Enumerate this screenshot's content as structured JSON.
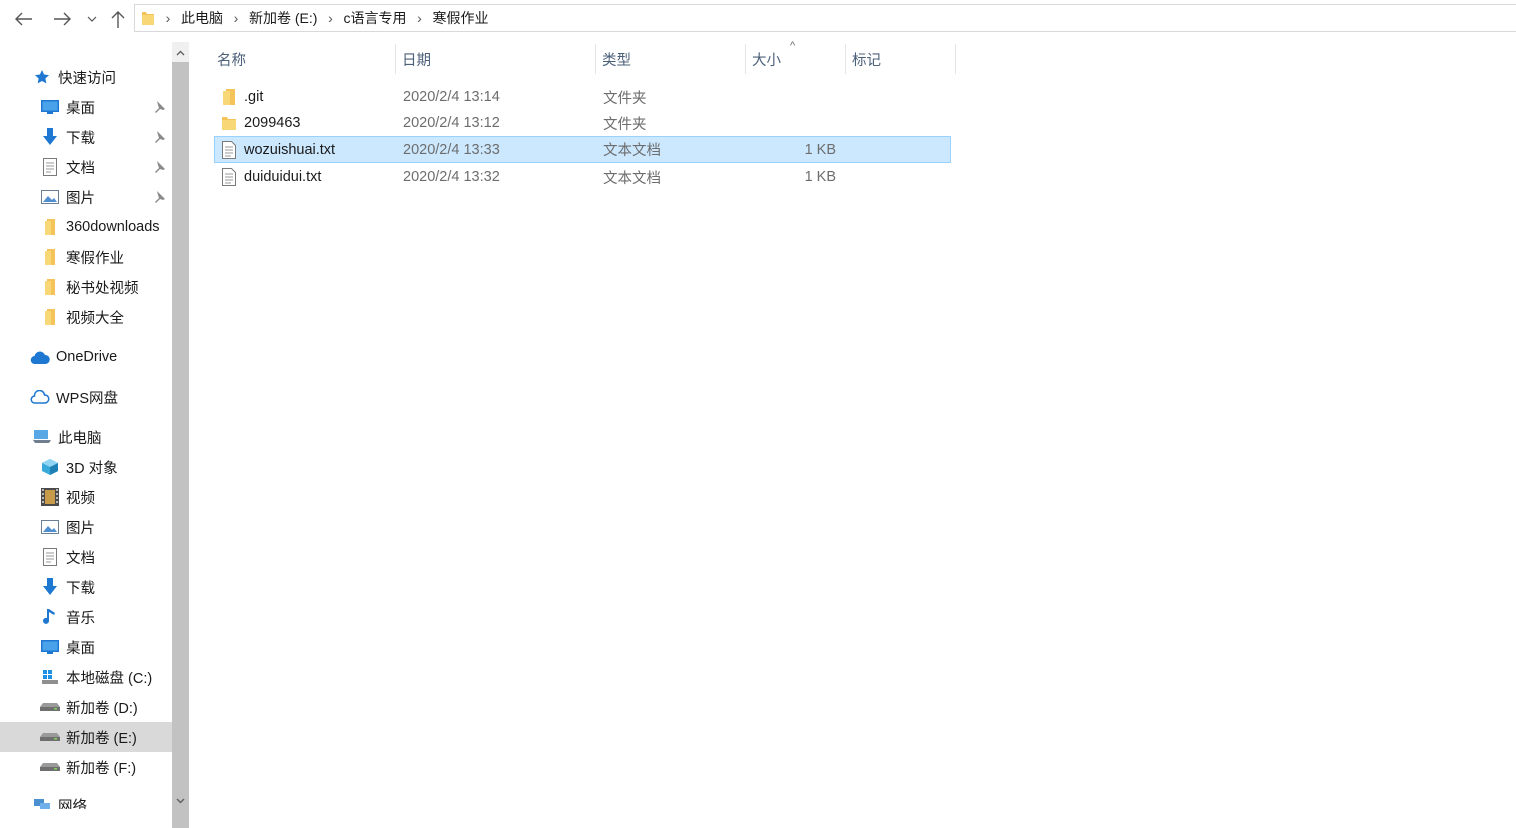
{
  "toolbar": {
    "back_icon": "arrow-left-icon",
    "forward_icon": "arrow-right-icon",
    "recent_icon": "chevron-down-icon",
    "up_icon": "arrow-up-icon"
  },
  "breadcrumb": [
    "此电脑",
    "新加卷 (E:)",
    "c语言专用",
    "寒假作业"
  ],
  "sidebar": {
    "quick_access": "快速访问",
    "quick_items": [
      {
        "label": "桌面",
        "icon": "desktop-icon"
      },
      {
        "label": "下载",
        "icon": "download-icon"
      },
      {
        "label": "文档",
        "icon": "document-icon"
      },
      {
        "label": "图片",
        "icon": "picture-icon"
      },
      {
        "label": "360downloads",
        "icon": "folder-icon"
      },
      {
        "label": "寒假作业",
        "icon": "folder-icon"
      },
      {
        "label": "秘书处视频",
        "icon": "folder-icon"
      },
      {
        "label": "视频大全",
        "icon": "folder-icon"
      }
    ],
    "onedrive": "OneDrive",
    "wps": "WPS网盘",
    "this_pc": "此电脑",
    "pc_items": [
      {
        "label": "3D 对象",
        "icon": "cube-icon"
      },
      {
        "label": "视频",
        "icon": "video-icon"
      },
      {
        "label": "图片",
        "icon": "picture-icon"
      },
      {
        "label": "文档",
        "icon": "document-icon"
      },
      {
        "label": "下载",
        "icon": "download-icon"
      },
      {
        "label": "音乐",
        "icon": "music-icon"
      },
      {
        "label": "桌面",
        "icon": "desktop-icon"
      },
      {
        "label": "本地磁盘 (C:)",
        "icon": "windows-drive-icon"
      },
      {
        "label": "新加卷 (D:)",
        "icon": "drive-icon"
      },
      {
        "label": "新加卷 (E:)",
        "icon": "drive-icon",
        "selected": true
      },
      {
        "label": "新加卷 (F:)",
        "icon": "drive-icon"
      }
    ],
    "network": "网络"
  },
  "columns": {
    "name": "名称",
    "date": "日期",
    "type": "类型",
    "size": "大小",
    "tags": "标记"
  },
  "sort_indicator": "^",
  "files": [
    {
      "name": ".git",
      "date": "2020/2/4 13:14",
      "type": "文件夹",
      "size": "",
      "kind": "folder"
    },
    {
      "name": "2099463",
      "date": "2020/2/4 13:12",
      "type": "文件夹",
      "size": "",
      "kind": "folder"
    },
    {
      "name": "wozuishuai.txt",
      "date": "2020/2/4 13:33",
      "type": "文本文档",
      "size": "1 KB",
      "kind": "text",
      "selected": true
    },
    {
      "name": "duiduidui.txt",
      "date": "2020/2/4 13:32",
      "type": "文本文档",
      "size": "1 KB",
      "kind": "text"
    }
  ],
  "colors": {
    "selection_bg": "#cce8ff",
    "selection_border": "#99d1ff",
    "header_text": "#4c607a",
    "folder": "#f4c45a",
    "accent": "#1e78d2"
  }
}
